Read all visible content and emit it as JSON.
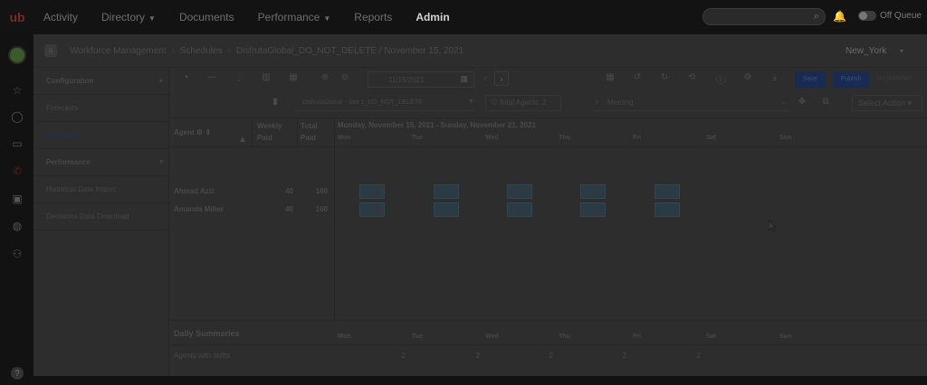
{
  "topnav": {
    "logo_text": "ub",
    "items": [
      {
        "label": "Activity",
        "caret": false,
        "active": false
      },
      {
        "label": "Directory",
        "caret": true,
        "active": false
      },
      {
        "label": "Documents",
        "caret": false,
        "active": false
      },
      {
        "label": "Performance",
        "caret": true,
        "active": false
      },
      {
        "label": "Reports",
        "caret": false,
        "active": false
      },
      {
        "label": "Admin",
        "caret": false,
        "active": true
      }
    ],
    "search_placeholder": "",
    "queue_label": "Off Queue"
  },
  "breadcrumb": {
    "items": [
      "Workforce Management",
      "Schedules",
      "DisfrutaGlobal_DO_NOT_DELETE / November 15, 2021"
    ],
    "timezone": "New_York"
  },
  "sidemenu": {
    "items": [
      {
        "label": "Configuration",
        "bold": true,
        "chevron": true,
        "active": false
      },
      {
        "label": "Forecasts",
        "bold": false,
        "chevron": false,
        "active": false
      },
      {
        "label": "Schedules",
        "bold": true,
        "chevron": false,
        "active": true
      },
      {
        "label": "Performance",
        "bold": true,
        "chevron": true,
        "active": false
      },
      {
        "label": "Historical Data Import",
        "bold": false,
        "chevron": false,
        "active": false
      },
      {
        "label": "Decisions Data Download",
        "bold": false,
        "chevron": false,
        "active": false
      }
    ]
  },
  "toolbar": {
    "date_value": "11/15/2021",
    "save_label": "Save",
    "publish_label": "Publish",
    "publish_status": "Not published",
    "site_value": "DisfrutaGlobal - Site 1_DO_NOT_DELETE",
    "total_agents": "Total Agents: 2",
    "activity_value": "Meeting",
    "select_action": "Select Action"
  },
  "grid": {
    "col_agent": "Agent",
    "col_weekly_1": "Weekly",
    "col_weekly_2": "Paid",
    "col_total_1": "Total",
    "col_total_2": "Paid",
    "range": "Monday, November 15, 2021 - Sunday, November 21, 2021",
    "days": [
      "Mon",
      "Tue",
      "Wed",
      "Thu",
      "Fri",
      "Sat",
      "Sun"
    ],
    "agents": [
      {
        "name": "Ahmad Aziz",
        "weekly": "40",
        "total": "160"
      },
      {
        "name": "Amanda Miller",
        "weekly": "40",
        "total": "160"
      }
    ]
  },
  "summaries": {
    "title": "Daily Summaries",
    "days": [
      "Mon",
      "Tue",
      "Wed",
      "Thu",
      "Fri",
      "Sat",
      "Sun"
    ],
    "row_label": "Agents with shifts",
    "values": [
      "2",
      "2",
      "2",
      "2",
      "2",
      "",
      ""
    ]
  },
  "colors": {
    "accent": "#1a2b52",
    "shift": "#2b3b45",
    "overlay_base": "#2d2d2d"
  }
}
